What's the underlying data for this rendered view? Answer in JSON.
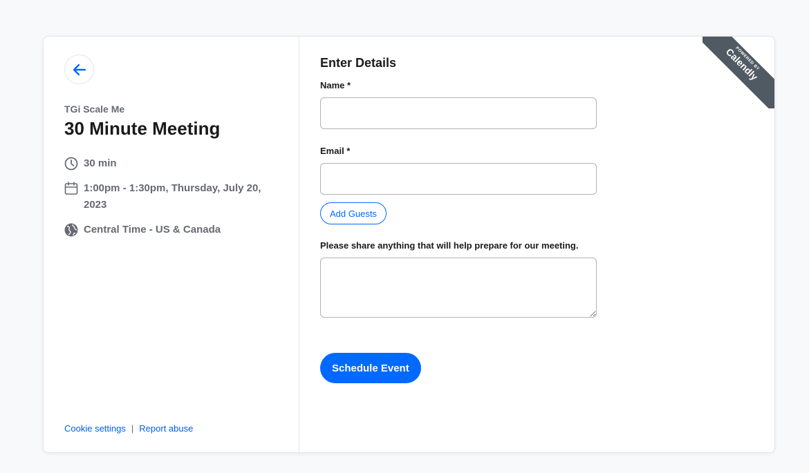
{
  "sidebar": {
    "organizer": "TGi Scale Me",
    "event_title": "30 Minute Meeting",
    "duration": "30 min",
    "datetime": "1:00pm - 1:30pm, Thursday, July 20, 2023",
    "timezone": "Central Time - US & Canada",
    "footer": {
      "cookie_settings": "Cookie settings",
      "separator": "|",
      "report_abuse": "Report abuse"
    }
  },
  "form": {
    "heading": "Enter Details",
    "name_label": "Name *",
    "name_value": "",
    "email_label": "Email *",
    "email_value": "",
    "add_guests_label": "Add Guests",
    "notes_label": "Please share anything that will help prepare for our meeting.",
    "notes_value": "",
    "submit_label": "Schedule Event"
  },
  "ribbon": {
    "powered_by": "POWERED BY",
    "brand": "Calendly"
  },
  "colors": {
    "accent": "#0069ff",
    "ribbon": "#505a62",
    "muted_text": "#666a73",
    "background": "#f8f9fb"
  },
  "icons": [
    "back-arrow-icon",
    "clock-icon",
    "calendar-icon",
    "globe-icon"
  ]
}
